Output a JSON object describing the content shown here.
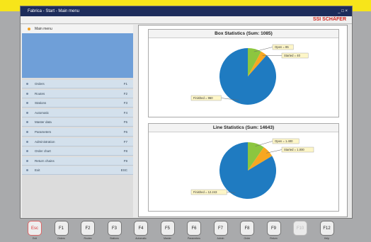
{
  "titlebar": {
    "title": "Fabrica - Start - Main menu",
    "controls": "_ □ ×"
  },
  "brand": "SSI SCHÄFER",
  "sidebar": {
    "header": "Main menu",
    "items": [
      {
        "label": "Orders",
        "key": "F1"
      },
      {
        "label": "Routes",
        "key": "F2"
      },
      {
        "label": "Stations",
        "key": "F3"
      },
      {
        "label": "Automatic",
        "key": "F4"
      },
      {
        "label": "Master data",
        "key": "F5"
      },
      {
        "label": "Parameters",
        "key": "F6"
      },
      {
        "label": "Administration",
        "key": "F7"
      },
      {
        "label": "Order chart",
        "key": "F8"
      },
      {
        "label": "Return chains",
        "key": "F9"
      },
      {
        "label": "Exit",
        "key": "ESC"
      }
    ]
  },
  "stats": {
    "box": {
      "title": "Box Statistics (Sum: 1085)",
      "labels": [
        "Open = 85",
        "Started = 40",
        "Finished = 960"
      ]
    },
    "line": {
      "title": "Line Statistics (Sum: 14643)",
      "labels": [
        "Open = 1.400",
        "Started = 1.000",
        "Finished = 12.243"
      ]
    }
  },
  "colors": {
    "open": "#8cc63f",
    "started": "#f7a721",
    "finished": "#1f7bc1",
    "accent": "#f7e51a"
  },
  "chart_data": [
    {
      "type": "pie",
      "title": "Box Statistics (Sum: 1085)",
      "categories": [
        "Open",
        "Started",
        "Finished"
      ],
      "values": [
        85,
        40,
        960
      ]
    },
    {
      "type": "pie",
      "title": "Line Statistics (Sum: 14643)",
      "categories": [
        "Open",
        "Started",
        "Finished"
      ],
      "values": [
        1400,
        1000,
        12243
      ]
    }
  ],
  "fkeys": [
    {
      "key": "Esc",
      "caption": "Exit",
      "disabled": false
    },
    {
      "key": "F1",
      "caption": "Orders",
      "disabled": false
    },
    {
      "key": "F2",
      "caption": "Routes",
      "disabled": false
    },
    {
      "key": "F3",
      "caption": "Stations",
      "disabled": false
    },
    {
      "key": "F4",
      "caption": "Automatic",
      "disabled": false
    },
    {
      "key": "F5",
      "caption": "Master",
      "disabled": false
    },
    {
      "key": "F6",
      "caption": "Parameters",
      "disabled": false
    },
    {
      "key": "F7",
      "caption": "Admin",
      "disabled": false
    },
    {
      "key": "F8",
      "caption": "Order",
      "disabled": false
    },
    {
      "key": "F9",
      "caption": "Return",
      "disabled": false
    },
    {
      "key": "F10",
      "caption": "",
      "disabled": true
    },
    {
      "key": "F12",
      "caption": "Help",
      "disabled": false
    }
  ]
}
